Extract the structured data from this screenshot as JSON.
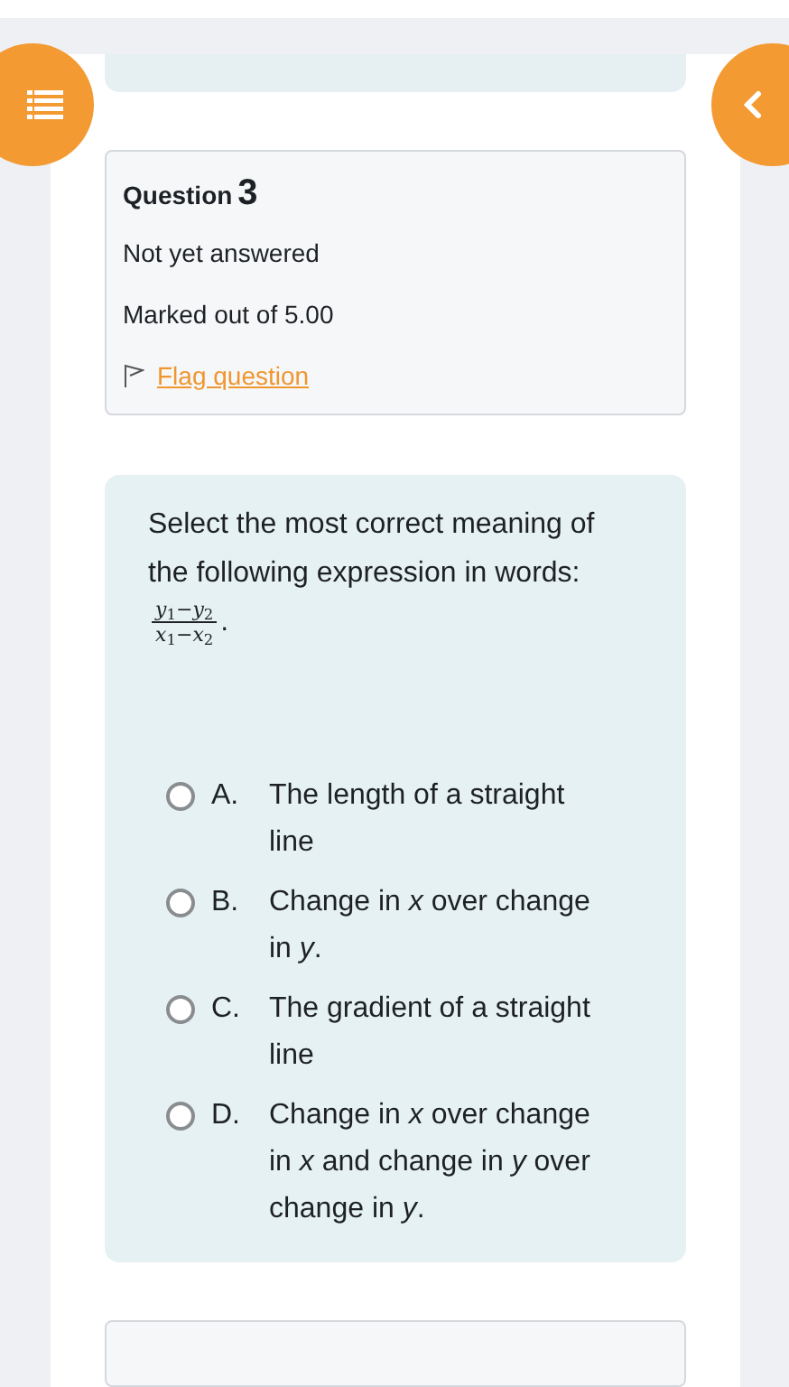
{
  "question": {
    "label": "Question",
    "number": "3",
    "status": "Not yet answered",
    "marks": "Marked out of 5.00",
    "flag": "Flag question"
  },
  "prompt": {
    "text": "Select the most correct meaning of the following expression in words:",
    "numerator": "*y*$_{1}$−*y*$_{2}$",
    "denominator": "*x*$_{1}$−*x*$_{2}$",
    "after": "."
  },
  "options": [
    {
      "letter": "A.",
      "text": "The length of a straight line",
      "selected": false
    },
    {
      "letter": "B.",
      "text": "Change in *x* over change in *y*.",
      "selected": false
    },
    {
      "letter": "C.",
      "text": "The gradient of a straight line",
      "selected": false
    },
    {
      "letter": "D.",
      "text": "Change in *x* over change in *x* and change in *y* over change in *y*.",
      "selected": false
    }
  ]
}
